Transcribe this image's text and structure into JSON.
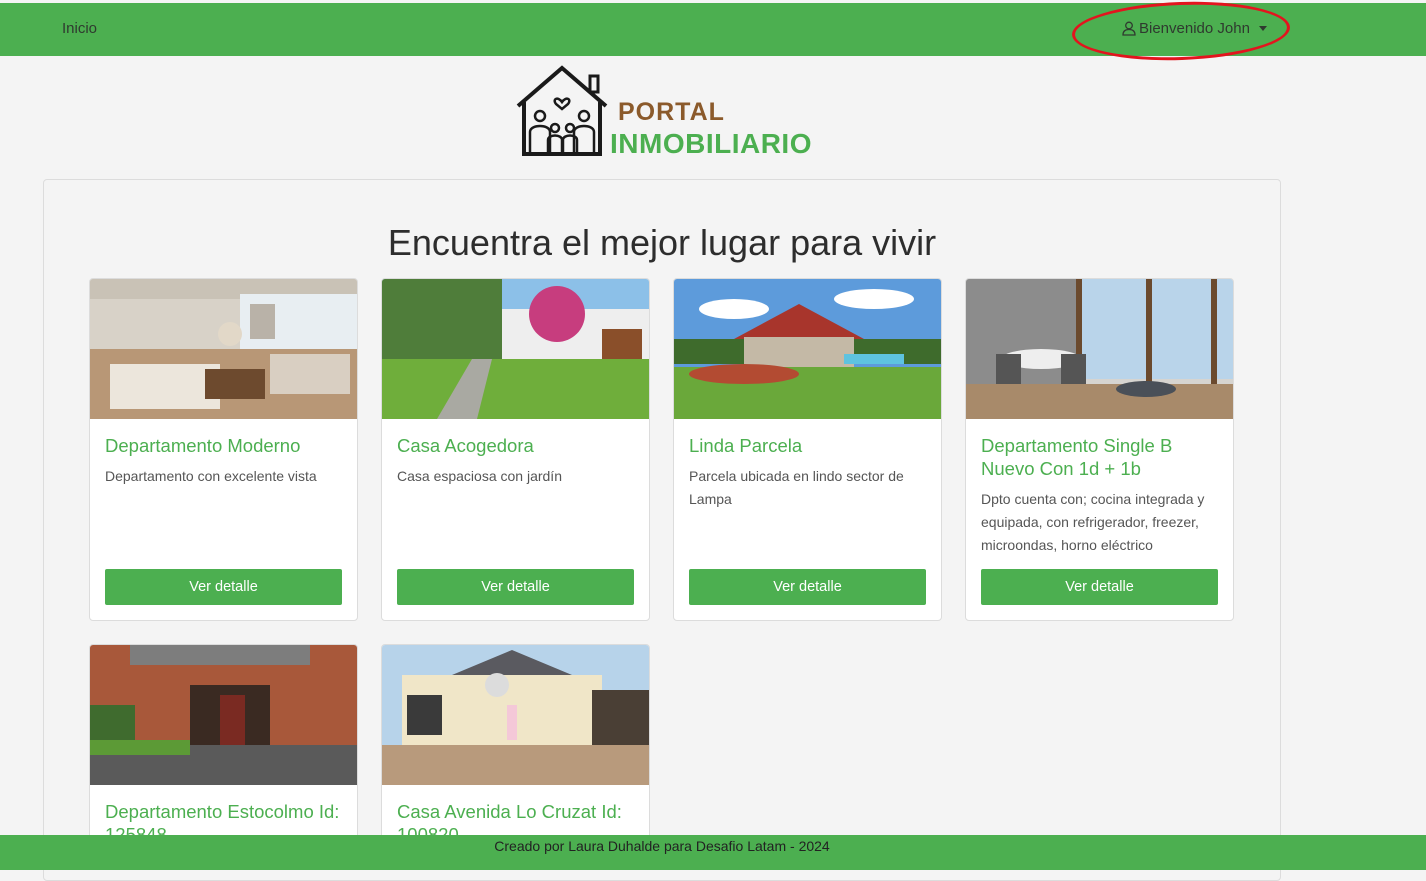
{
  "navbar": {
    "home_label": "Inicio",
    "user_label": "Bienvenido John"
  },
  "logo": {
    "line1": "PORTAL",
    "line2": "INMOBILIARIO"
  },
  "headline": "Encuentra el mejor lugar para vivir",
  "cards": [
    {
      "title": "Departamento Moderno",
      "description": "Departamento con excelente vista",
      "button": "Ver detalle"
    },
    {
      "title": "Casa Acogedora",
      "description": "Casa espaciosa con jardín",
      "button": "Ver detalle"
    },
    {
      "title": "Linda Parcela",
      "description": "Parcela ubicada en lindo sector de Lampa",
      "button": "Ver detalle"
    },
    {
      "title": "Departamento Single B Nuevo Con 1d + 1b",
      "description": "Dpto cuenta con; cocina integrada y equipada, con refrigerador, freezer, microondas, horno eléctrico",
      "button": "Ver detalle"
    },
    {
      "title": "Departamento Estocolmo Id: 125848"
    },
    {
      "title": "Casa Avenida Lo Cruzat Id: 100820"
    }
  ],
  "footer": {
    "text": "Creado por Laura Duhalde para Desafio Latam - 2024"
  },
  "colors": {
    "brand_green": "#4caf50",
    "logo_brown": "#8b5a2b",
    "annotation_red": "#e3141e"
  },
  "icons": [
    "user-icon",
    "caret-down-icon",
    "house-family-logo"
  ]
}
